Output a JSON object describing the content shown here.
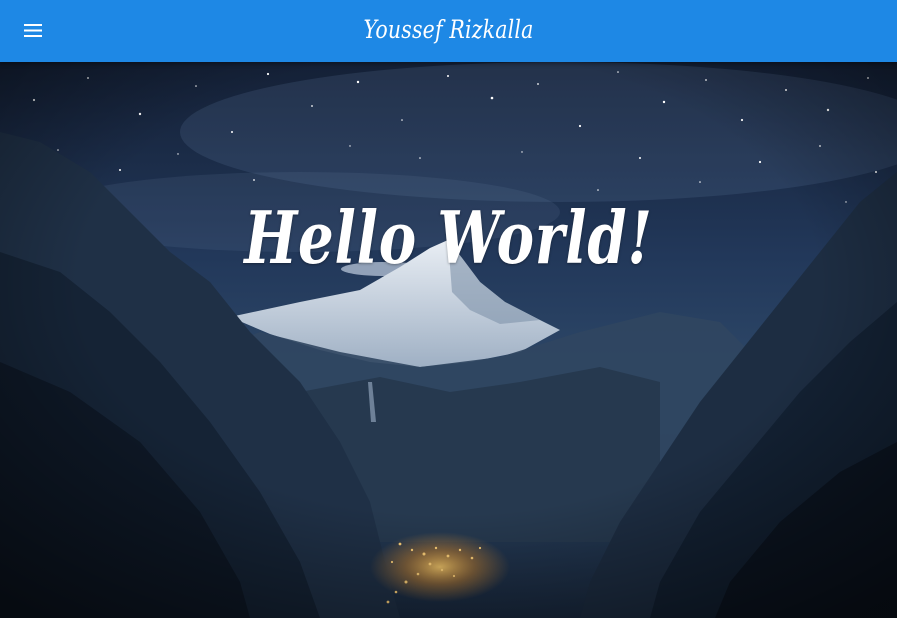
{
  "header": {
    "menu_icon": "hamburger-menu-icon",
    "title": "Youssef Rizkalla",
    "background_color": "#1e88e5"
  },
  "hero": {
    "heading": "Hello World!",
    "background": "night mountain landscape"
  }
}
